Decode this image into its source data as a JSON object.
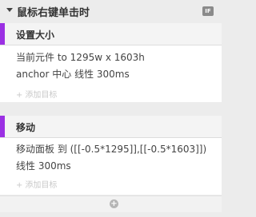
{
  "trigger": {
    "title": "鼠标右键单击时",
    "badge": "IF"
  },
  "actions": [
    {
      "title": "设置大小",
      "lines": [
        "当前元件 to 1295w x 1603h",
        "anchor 中心 线性 300ms"
      ],
      "add_target": "添加目标"
    },
    {
      "title": "移动",
      "lines": [
        "移动面板 到 ([[-0.5*1295]],[[-0.5*1603]])",
        "线性 300ms"
      ],
      "add_target": "添加目标"
    }
  ],
  "colors": {
    "accent": "#9b30e3"
  },
  "icons": {
    "collapse": "collapse-arrow-icon",
    "add_action": "add-action-icon"
  }
}
